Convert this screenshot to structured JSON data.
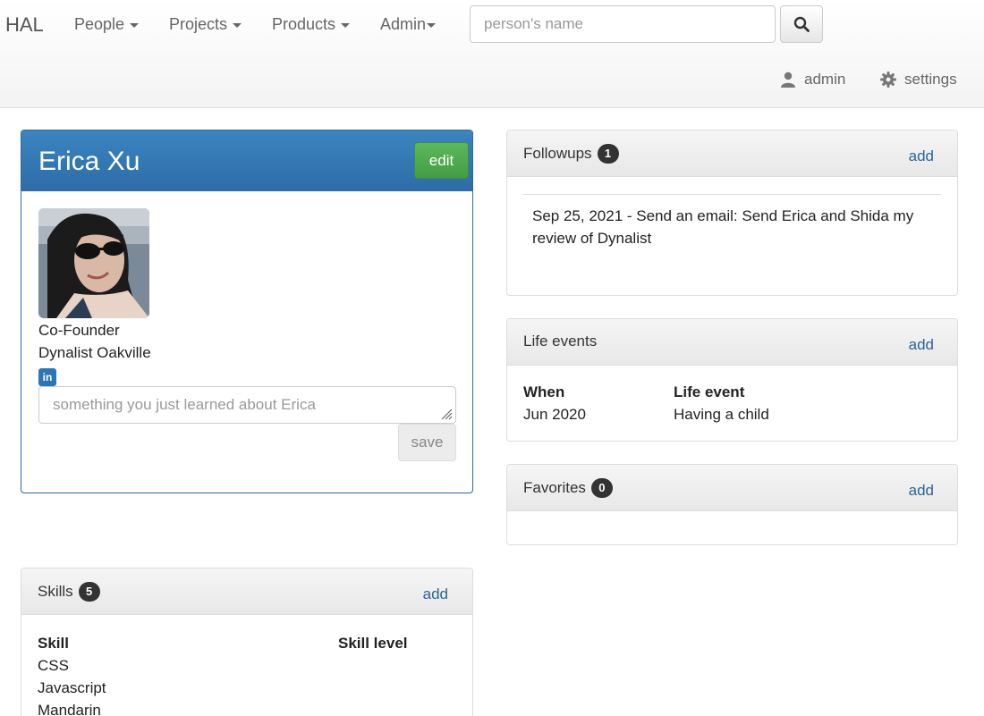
{
  "navbar": {
    "brand": "HAL",
    "menu": [
      {
        "label": "People",
        "caret": true
      },
      {
        "label": "Projects",
        "caret": true
      },
      {
        "label": "Products",
        "caret": true
      },
      {
        "label": "Admin",
        "caret": true
      }
    ],
    "search_placeholder": "person's name",
    "search_icon": "search-icon",
    "user_label": "admin",
    "settings_label": "settings"
  },
  "profile": {
    "name": "Erica Xu",
    "edit_label": "edit",
    "title": "Co-Founder",
    "company": "Dynalist Oakville",
    "linkedin_letters": "in",
    "note_placeholder": "something you just learned about Erica",
    "save_label": "save"
  },
  "followups": {
    "title": "Followups",
    "count": "1",
    "add_label": "add",
    "items": [
      "Sep 25, 2021 - Send an email: Send Erica and Shida my review of Dynalist"
    ]
  },
  "life_events": {
    "title": "Life events",
    "add_label": "add",
    "headers": [
      "When",
      "Life event"
    ],
    "rows": [
      [
        "Jun 2020",
        "Having a child"
      ]
    ]
  },
  "favorites": {
    "title": "Favorites",
    "count": "0",
    "add_label": "add"
  },
  "skills": {
    "title": "Skills",
    "count": "5",
    "add_label": "add",
    "headers": [
      "Skill",
      "Skill level"
    ],
    "items": [
      "CSS",
      "Javascript",
      "Mandarin"
    ]
  },
  "colors": {
    "profile_header": "#337ab7",
    "edit_button": "#5cb85c",
    "link": "#2a6496",
    "badge": "#333333"
  }
}
